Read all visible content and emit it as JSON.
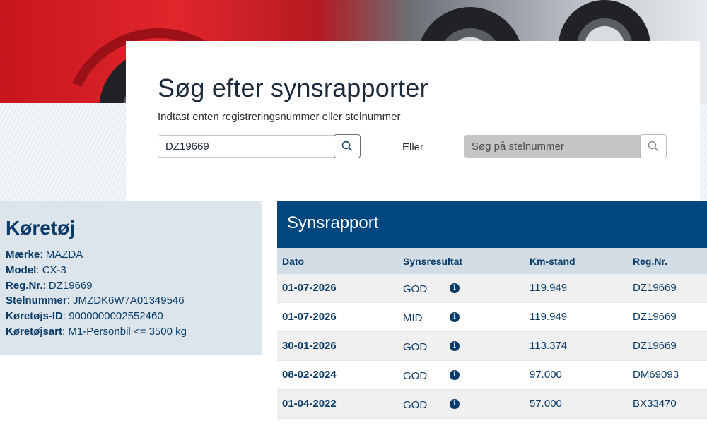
{
  "search": {
    "title": "Søg efter synsrapporter",
    "subtitle": "Indtast enten registreringsnummer eller stelnummer",
    "reg_value": "DZ19669",
    "or_label": "Eller",
    "vin_placeholder": "Søg på stelnummer",
    "search_icon": "search-icon"
  },
  "vehicle": {
    "heading": "Køretøj",
    "fields": [
      {
        "label": "Mærke",
        "value": "MAZDA"
      },
      {
        "label": "Model",
        "value": "CX-3"
      },
      {
        "label": "Reg.Nr.",
        "value": "DZ19669"
      },
      {
        "label": "Stelnummer",
        "value": "JMZDK6W7A01349546"
      },
      {
        "label": "Køretøjs-ID",
        "value": "9000000002552460"
      },
      {
        "label": "Køretøjsart",
        "value": "M1-Personbil <= 3500 kg"
      }
    ]
  },
  "report": {
    "title": "Synsrapport",
    "columns": [
      "Dato",
      "Synsresultat",
      "Km-stand",
      "Reg.Nr."
    ],
    "rows": [
      {
        "date": "01-07-2026",
        "result": "GOD",
        "km": "119.949",
        "reg": "DZ19669"
      },
      {
        "date": "01-07-2026",
        "result": "MID",
        "km": "119.949",
        "reg": "DZ19669"
      },
      {
        "date": "30-01-2026",
        "result": "GOD",
        "km": "113.374",
        "reg": "DZ19669"
      },
      {
        "date": "08-02-2024",
        "result": "GOD",
        "km": "97.000",
        "reg": "DM69093"
      },
      {
        "date": "01-04-2022",
        "result": "GOD",
        "km": "57.000",
        "reg": "BX33470"
      }
    ],
    "info_icon_glyph": "i"
  },
  "colors": {
    "primary": "#00467f",
    "panel": "#dce5ec",
    "table_header": "#d3dde6"
  }
}
